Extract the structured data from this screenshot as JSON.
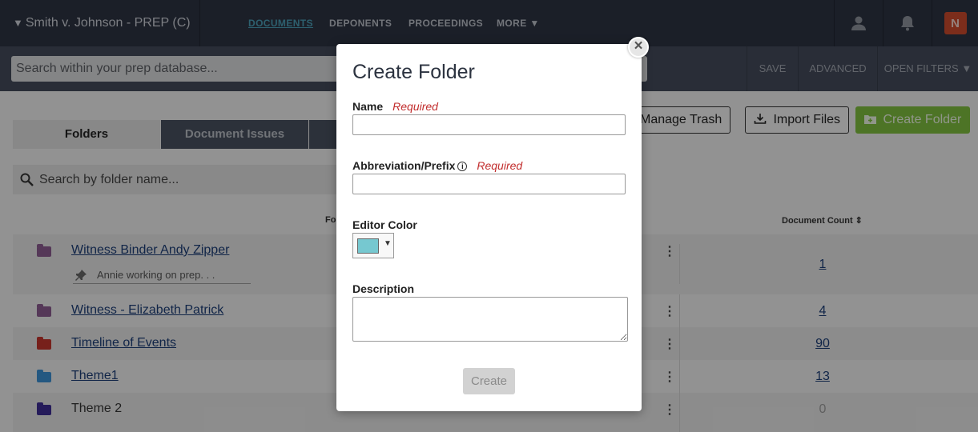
{
  "topbar": {
    "case_title": "Smith v. Johnson - PREP (C)",
    "case_caret": "▼",
    "nav": [
      {
        "label": "DOCUMENTS",
        "active": true
      },
      {
        "label": "DEPONENTS",
        "active": false
      },
      {
        "label": "PROCEEDINGS",
        "active": false
      },
      {
        "label": "MORE ▼",
        "active": false
      }
    ],
    "icons": [
      "user-icon",
      "bell-icon",
      "app-logo-icon"
    ],
    "logo_glyph": "N"
  },
  "searchbar": {
    "placeholder": "Search within your prep database...",
    "save_label": "SAVE",
    "advanced_label": "ADVANCED",
    "filters_label": "OPEN FILTERS ▼"
  },
  "tabs": [
    {
      "label": "Folders",
      "active": true
    },
    {
      "label": "Document Issues",
      "active": false
    }
  ],
  "toolbar": {
    "manage_trash": "Manage Trash",
    "import_files": "Import Files",
    "create_folder": "Create Folder"
  },
  "folder_search": {
    "placeholder": "Search by folder name..."
  },
  "table": {
    "col_folder": "Fo",
    "col_count": "Document Count ⇕",
    "rows": [
      {
        "name": "Witness Binder Andy Zipper",
        "count": "1",
        "color": "#8a5b8e",
        "linked": true,
        "note": "Annie working on prep. . ."
      },
      {
        "name": "Witness - Elizabeth Patrick",
        "count": "4",
        "color": "#8a5b8e",
        "linked": true
      },
      {
        "name": "Timeline of Events",
        "count": "90",
        "color": "#c0342c",
        "linked": true
      },
      {
        "name": "Theme1",
        "count": "13",
        "color": "#3b8fd0",
        "linked": true
      },
      {
        "name": "Theme 2",
        "count": "0",
        "color": "#3d2c91",
        "linked": false
      }
    ]
  },
  "modal": {
    "title": "Create Folder",
    "name_label": "Name",
    "abbrev_label": "Abbreviation/Prefix",
    "required": "Required",
    "info_glyph": "i",
    "color_label": "Editor Color",
    "color_value": "#76c8d0",
    "picker_caret": "▼",
    "description_label": "Description",
    "create_label": "Create",
    "close_glyph": "×"
  }
}
